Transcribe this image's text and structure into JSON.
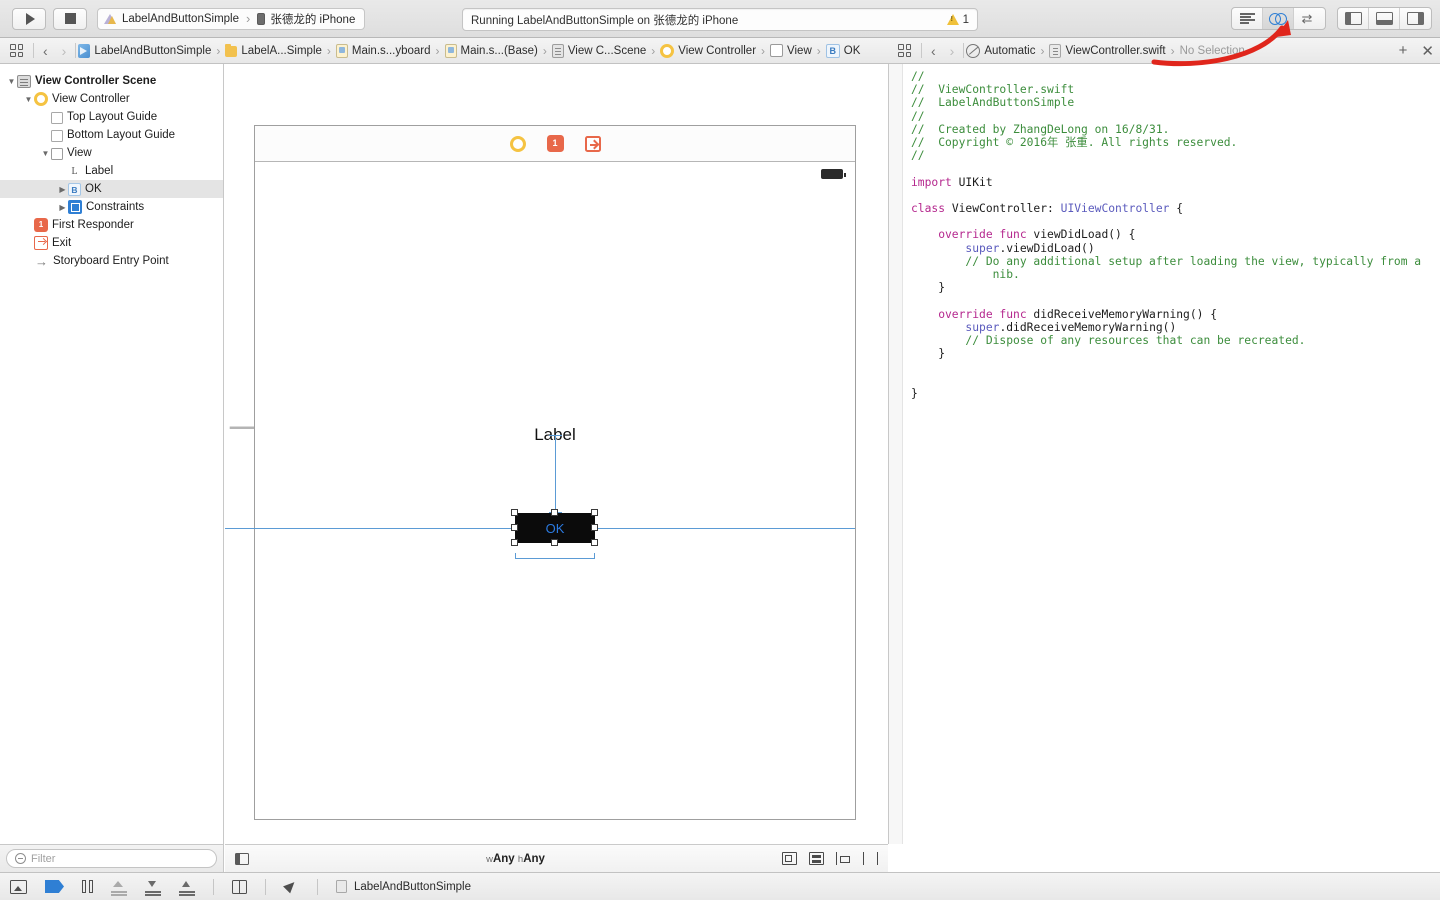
{
  "toolbar": {
    "run_label": "Run",
    "stop_label": "Stop",
    "scheme_name": "LabelAndButtonSimple",
    "scheme_separator": "›",
    "destination": "张德龙的 iPhone",
    "status_text": "Running LabelAndButtonSimple on 张德龙的 iPhone",
    "warning_count": "1",
    "editor_modes": [
      {
        "name": "standard-editor",
        "icon": "lines-icon",
        "active": false
      },
      {
        "name": "assistant-editor",
        "icon": "venn-icon",
        "active": true
      },
      {
        "name": "version-editor",
        "icon": "arrows-icon",
        "active": false
      }
    ],
    "view_toggles": [
      {
        "name": "toggle-navigator",
        "icon": "panel-left-icon"
      },
      {
        "name": "toggle-debug-area",
        "icon": "panel-bottom-icon"
      },
      {
        "name": "toggle-utilities",
        "icon": "panel-right-icon"
      }
    ]
  },
  "jumpbar_left": {
    "back_glyph": "‹",
    "forward_glyph": "›",
    "crumbs": [
      {
        "label": "LabelAndButtonSimple",
        "icon": "project-icon"
      },
      {
        "label": "LabelA...Simple",
        "icon": "folder-icon"
      },
      {
        "label": "Main.s...yboard",
        "icon": "storyboard-icon"
      },
      {
        "label": "Main.s...(Base)",
        "icon": "storyboard-icon"
      },
      {
        "label": "View C...Scene",
        "icon": "scene-icon"
      },
      {
        "label": "View Controller",
        "icon": "view-controller-icon"
      },
      {
        "label": "View",
        "icon": "view-icon"
      },
      {
        "label": "OK",
        "icon": "button-icon"
      }
    ]
  },
  "jumpbar_right": {
    "back_glyph": "‹",
    "forward_glyph": "›",
    "crumbs": [
      {
        "label": "Automatic",
        "icon": "automatic-icon",
        "dim": false
      },
      {
        "label": "ViewController.swift",
        "icon": "swift-file-icon",
        "dim": false
      },
      {
        "label": "No Selection",
        "icon": "",
        "dim": true
      }
    ],
    "add_label": "+",
    "close_label": "✕"
  },
  "navigator": {
    "tree": [
      {
        "label": "View Controller Scene",
        "depth": 0,
        "twisty": "open",
        "icon": "scene-icon",
        "bold": true,
        "selected": false
      },
      {
        "label": "View Controller",
        "depth": 1,
        "twisty": "open",
        "icon": "view-controller-icon",
        "bold": false,
        "selected": false
      },
      {
        "label": "Top Layout Guide",
        "depth": 2,
        "twisty": "none",
        "icon": "layout-guide-icon",
        "bold": false,
        "selected": false
      },
      {
        "label": "Bottom Layout Guide",
        "depth": 2,
        "twisty": "none",
        "icon": "layout-guide-icon",
        "bold": false,
        "selected": false
      },
      {
        "label": "View",
        "depth": 2,
        "twisty": "open",
        "icon": "view-icon",
        "bold": false,
        "selected": false
      },
      {
        "label": "Label",
        "depth": 3,
        "twisty": "none",
        "icon": "label-icon",
        "bold": false,
        "selected": false
      },
      {
        "label": "OK",
        "depth": 3,
        "twisty": "closed",
        "icon": "button-icon",
        "bold": false,
        "selected": true
      },
      {
        "label": "Constraints",
        "depth": 3,
        "twisty": "closed",
        "icon": "constraints-icon",
        "bold": false,
        "selected": false
      },
      {
        "label": "First Responder",
        "depth": 1,
        "twisty": "none",
        "icon": "first-responder-icon",
        "bold": false,
        "selected": false
      },
      {
        "label": "Exit",
        "depth": 1,
        "twisty": "none",
        "icon": "exit-icon",
        "bold": false,
        "selected": false
      },
      {
        "label": "Storyboard Entry Point",
        "depth": 1,
        "twisty": "none",
        "icon": "entry-point-icon",
        "bold": false,
        "selected": false
      }
    ],
    "filter_placeholder": "Filter"
  },
  "canvas": {
    "dock_items": [
      {
        "name": "view-controller-dock-icon"
      },
      {
        "name": "first-responder-dock-icon"
      },
      {
        "name": "exit-dock-icon"
      }
    ],
    "label_text": "Label",
    "button_text": "OK",
    "size_class_w_prefix": "w",
    "size_class_w": "Any",
    "size_class_h_prefix": "h",
    "size_class_h": "Any",
    "bottom_tools": [
      {
        "name": "embed-in-button",
        "icon": "embed-icon"
      },
      {
        "name": "align-button",
        "icon": "align-icon"
      },
      {
        "name": "pin-button",
        "icon": "pin-icon"
      },
      {
        "name": "resolve-auto-layout-issues-button",
        "icon": "resolve-icon"
      }
    ]
  },
  "editor": {
    "lines": [
      [
        {
          "t": "//",
          "c": "cm"
        }
      ],
      [
        {
          "t": "//  ViewController.swift",
          "c": "cm"
        }
      ],
      [
        {
          "t": "//  LabelAndButtonSimple",
          "c": "cm"
        }
      ],
      [
        {
          "t": "//",
          "c": "cm"
        }
      ],
      [
        {
          "t": "//  Created by ZhangDeLong on 16/8/31.",
          "c": "cm"
        }
      ],
      [
        {
          "t": "//  Copyright © 2016年 张重. All rights reserved.",
          "c": "cm"
        }
      ],
      [
        {
          "t": "//",
          "c": "cm"
        }
      ],
      [
        {
          "t": "",
          "c": "pl"
        }
      ],
      [
        {
          "t": "import",
          "c": "kw"
        },
        {
          "t": " UIKit",
          "c": "pl"
        }
      ],
      [
        {
          "t": "",
          "c": "pl"
        }
      ],
      [
        {
          "t": "class",
          "c": "kw"
        },
        {
          "t": " ViewController: ",
          "c": "pl"
        },
        {
          "t": "UIViewController",
          "c": "ty"
        },
        {
          "t": " {",
          "c": "pl"
        }
      ],
      [
        {
          "t": "",
          "c": "pl"
        }
      ],
      [
        {
          "t": "    override func",
          "c": "kw"
        },
        {
          "t": " viewDidLoad() {",
          "c": "pl"
        }
      ],
      [
        {
          "t": "        ",
          "c": "pl"
        },
        {
          "t": "super",
          "c": "ty"
        },
        {
          "t": ".viewDidLoad()",
          "c": "pl"
        }
      ],
      [
        {
          "t": "        // Do any additional setup after loading the view, typically from a",
          "c": "cm"
        }
      ],
      [
        {
          "t": "            nib.",
          "c": "cm"
        }
      ],
      [
        {
          "t": "    }",
          "c": "pl"
        }
      ],
      [
        {
          "t": "",
          "c": "pl"
        }
      ],
      [
        {
          "t": "    override func",
          "c": "kw"
        },
        {
          "t": " didReceiveMemoryWarning() {",
          "c": "pl"
        }
      ],
      [
        {
          "t": "        ",
          "c": "pl"
        },
        {
          "t": "super",
          "c": "ty"
        },
        {
          "t": ".didReceiveMemoryWarning()",
          "c": "pl"
        }
      ],
      [
        {
          "t": "        // Dispose of any resources that can be recreated.",
          "c": "cm"
        }
      ],
      [
        {
          "t": "    }",
          "c": "pl"
        }
      ],
      [
        {
          "t": "",
          "c": "pl"
        }
      ],
      [
        {
          "t": "",
          "c": "pl"
        }
      ],
      [
        {
          "t": "}",
          "c": "pl"
        }
      ]
    ]
  },
  "debugbar": {
    "buttons": [
      {
        "name": "hide-debug-area-button",
        "icon": "hide-debug-icon"
      },
      {
        "name": "activate-breakpoints-button",
        "icon": "breakpoint-icon"
      },
      {
        "name": "pause-button",
        "icon": "pause-icon"
      },
      {
        "name": "step-over-button",
        "icon": "step-over-icon"
      },
      {
        "name": "step-into-button",
        "icon": "step-into-icon"
      },
      {
        "name": "step-out-button",
        "icon": "step-out-icon"
      },
      {
        "name": "view-debugging-button",
        "icon": "view-debug-icon"
      },
      {
        "name": "simulate-location-button",
        "icon": "location-icon"
      }
    ],
    "process_label": "LabelAndButtonSimple"
  },
  "colors": {
    "accent_blue": "#2f7fd4",
    "annotation_red": "#e0261c",
    "warning_yellow": "#f0c13a",
    "comment_green": "#3c8d3c",
    "keyword_magenta": "#b5288e",
    "type_purple": "#5b5bbd"
  }
}
